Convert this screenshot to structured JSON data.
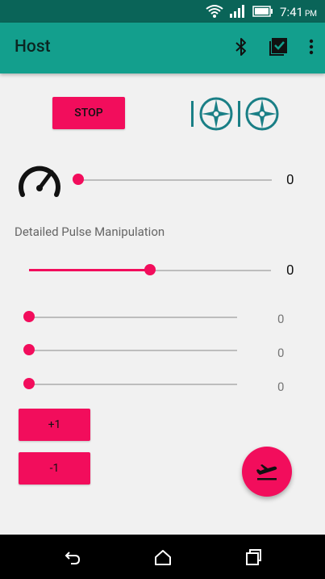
{
  "status_bar": {
    "time": "7:41",
    "ampm": "PM"
  },
  "app_bar": {
    "title": "Host"
  },
  "controls": {
    "stop_label": "STOP",
    "speed": {
      "value": "0",
      "level": 0.0
    },
    "section_label": "Detailed Pulse Manipulation",
    "master": {
      "value": "0",
      "level": 0.5
    },
    "channels": [
      {
        "value": "0",
        "level": 0.0
      },
      {
        "value": "0",
        "level": 0.0
      },
      {
        "value": "0",
        "level": 0.0
      }
    ],
    "increment_label": "+1",
    "decrement_label": "-1"
  },
  "colors": {
    "accent": "#f20d5c",
    "toolbar": "#139f8d",
    "status_bar": "#0a6458",
    "propeller_icon": "#1a7f86"
  },
  "icons": {
    "bluetooth": "bluetooth-icon",
    "checklist": "checklist-icon",
    "menu": "more-vert-icon",
    "gauge": "speedometer-icon",
    "drone": "propeller-icon",
    "fab": "flight-takeoff-icon",
    "nav": [
      "back-icon",
      "home-icon",
      "recents-icon"
    ]
  }
}
